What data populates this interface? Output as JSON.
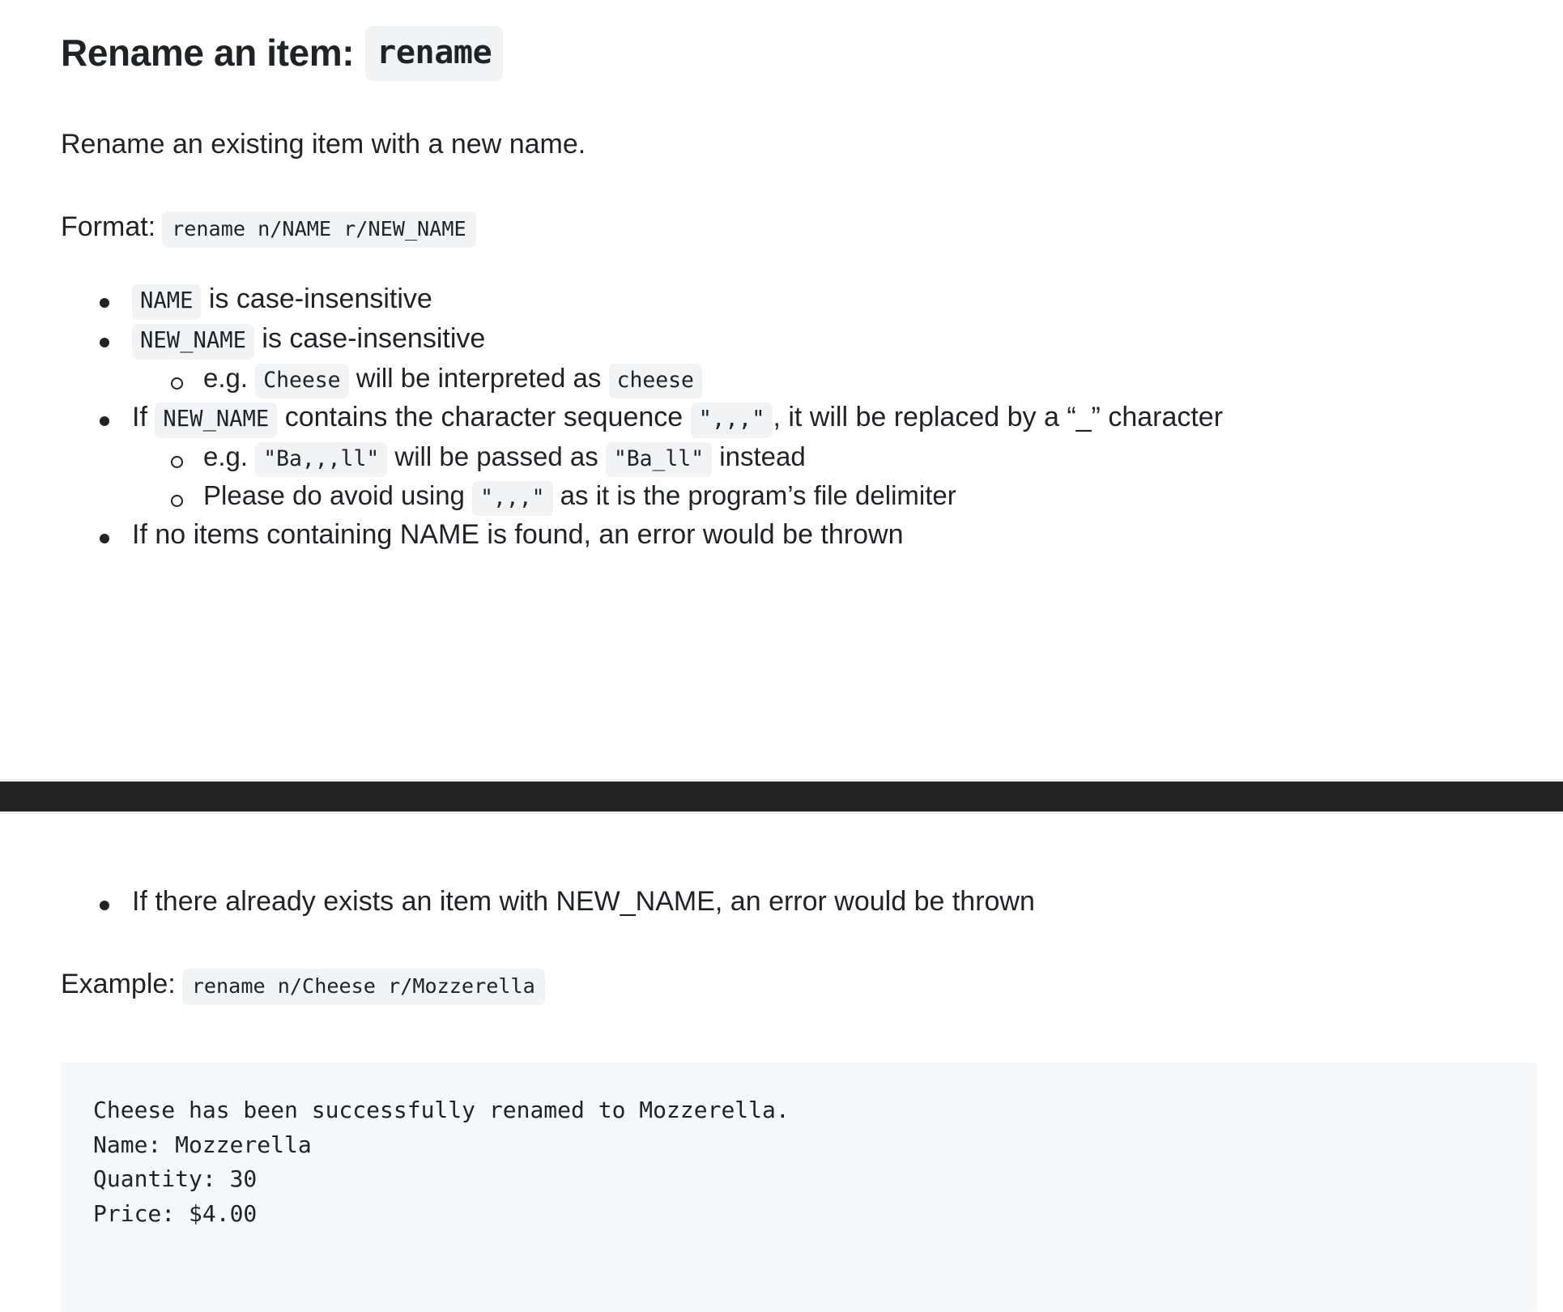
{
  "doc": {
    "title_text": "Rename an item:",
    "title_code": "rename",
    "description": "Rename an existing item with a new name.",
    "format_label": "Format:",
    "format_code": "rename n/NAME r/NEW_NAME",
    "example_label": "Example:",
    "example_code": "rename n/Cheese r/Mozzerella"
  },
  "bullets_top": [
    {
      "id": "name-case",
      "parts": [
        {
          "type": "code",
          "text": "NAME"
        },
        {
          "type": "text",
          "text": " is case-insensitive"
        }
      ],
      "children": []
    },
    {
      "id": "new-name-case",
      "parts": [
        {
          "type": "code",
          "text": "NEW_NAME"
        },
        {
          "type": "text",
          "text": " is case-insensitive"
        }
      ],
      "children": [
        {
          "id": "cheese-example",
          "parts": [
            {
              "type": "text",
              "text": "e.g. "
            },
            {
              "type": "code",
              "text": "Cheese"
            },
            {
              "type": "text",
              "text": " will be interpreted as "
            },
            {
              "type": "code",
              "text": "cheese"
            }
          ]
        }
      ]
    },
    {
      "id": "comma-sequence",
      "parts": [
        {
          "type": "text",
          "text": "If "
        },
        {
          "type": "code",
          "text": "NEW_NAME"
        },
        {
          "type": "text",
          "text": " contains the character sequence "
        },
        {
          "type": "code",
          "text": "\",,,\""
        },
        {
          "type": "text",
          "text": ", it will be replaced by a “_” character"
        }
      ],
      "children": [
        {
          "id": "ball-example",
          "parts": [
            {
              "type": "text",
              "text": "e.g. "
            },
            {
              "type": "code",
              "text": "\"Ba,,,ll\""
            },
            {
              "type": "text",
              "text": " will be passed as "
            },
            {
              "type": "code",
              "text": "\"Ba_ll\""
            },
            {
              "type": "text",
              "text": " instead"
            }
          ]
        },
        {
          "id": "avoid-delimiter",
          "parts": [
            {
              "type": "text",
              "text": "Please do avoid using "
            },
            {
              "type": "code",
              "text": "\",,,\""
            },
            {
              "type": "text",
              "text": " as it is the program’s file delimiter"
            }
          ]
        }
      ]
    },
    {
      "id": "no-items-error",
      "parts": [
        {
          "type": "text",
          "text": "If no items containing NAME is found, an error would be thrown"
        }
      ],
      "children": []
    }
  ],
  "bullets_bottom": [
    {
      "id": "duplicate-error",
      "parts": [
        {
          "type": "text",
          "text": "If there already exists an item with NEW_NAME, an error would be thrown"
        }
      ],
      "children": []
    }
  ],
  "output_block": {
    "lines": [
      "Cheese has been successfully renamed to Mozzerella.",
      "Name: Mozzerella",
      "Quantity: 30",
      "Price: $4.00"
    ]
  },
  "colors": {
    "text": "#1f2328",
    "chip_bg": "#f2f3f5",
    "code_block_bg": "#f5f7f9",
    "band_dark": "#242424",
    "band_line": "#efeff0",
    "page_bg": "#ffffff"
  }
}
